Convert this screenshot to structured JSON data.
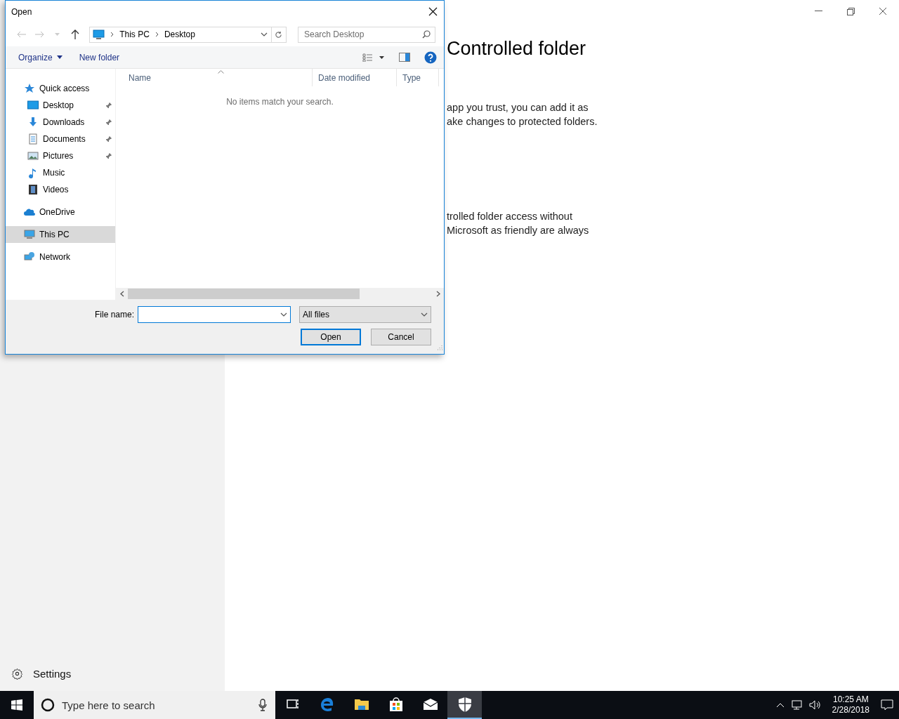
{
  "settings_page": {
    "heading": "Controlled folder",
    "paragraphs": [
      {
        "lines": [
          "app you trust, you can add it as",
          "ake changes to protected folders."
        ]
      },
      {
        "lines": [
          "trolled folder access without",
          "Microsoft as friendly are always"
        ]
      }
    ],
    "sidebar_footer": {
      "label": "Settings"
    }
  },
  "dialog": {
    "title": "Open",
    "address": {
      "segments": [
        "This PC",
        "Desktop"
      ]
    },
    "search": {
      "placeholder": "Search Desktop"
    },
    "toolbar": {
      "organize": "Organize",
      "new_folder": "New folder"
    },
    "nav_pane": [
      {
        "label": "Quick access",
        "kind": "quick-access",
        "selected": false,
        "children": [
          {
            "label": "Desktop",
            "kind": "desktop",
            "pinned": true,
            "selected": false
          },
          {
            "label": "Downloads",
            "kind": "downloads",
            "pinned": true,
            "selected": false
          },
          {
            "label": "Documents",
            "kind": "documents",
            "pinned": true,
            "selected": false
          },
          {
            "label": "Pictures",
            "kind": "pictures",
            "pinned": true,
            "selected": false
          },
          {
            "label": "Music",
            "kind": "music",
            "pinned": false,
            "selected": false
          },
          {
            "label": "Videos",
            "kind": "videos",
            "pinned": false,
            "selected": false
          }
        ]
      },
      {
        "label": "OneDrive",
        "kind": "onedrive",
        "selected": false
      },
      {
        "label": "This PC",
        "kind": "pc",
        "selected": true
      },
      {
        "label": "Network",
        "kind": "network",
        "selected": false
      }
    ],
    "columns": [
      {
        "label": "Name",
        "sorted": true
      },
      {
        "label": "Date modified",
        "sorted": false
      },
      {
        "label": "Type",
        "sorted": false
      }
    ],
    "empty_message": "No items match your search.",
    "file_name": {
      "label": "File name:"
    },
    "file_type": {
      "value": "All files"
    },
    "buttons": [
      {
        "label": "Open",
        "default": true
      },
      {
        "label": "Cancel",
        "default": false
      }
    ]
  },
  "taskbar": {
    "search_placeholder": "Type here to search",
    "apps": [
      {
        "kind": "task-view",
        "selected": false
      },
      {
        "kind": "browser",
        "selected": false
      },
      {
        "kind": "folder",
        "selected": false
      },
      {
        "kind": "store",
        "selected": false
      },
      {
        "kind": "mail",
        "selected": false
      },
      {
        "kind": "shield",
        "selected": true
      }
    ],
    "clock": {
      "time": "10:25 AM",
      "date": "2/28/2018"
    }
  }
}
